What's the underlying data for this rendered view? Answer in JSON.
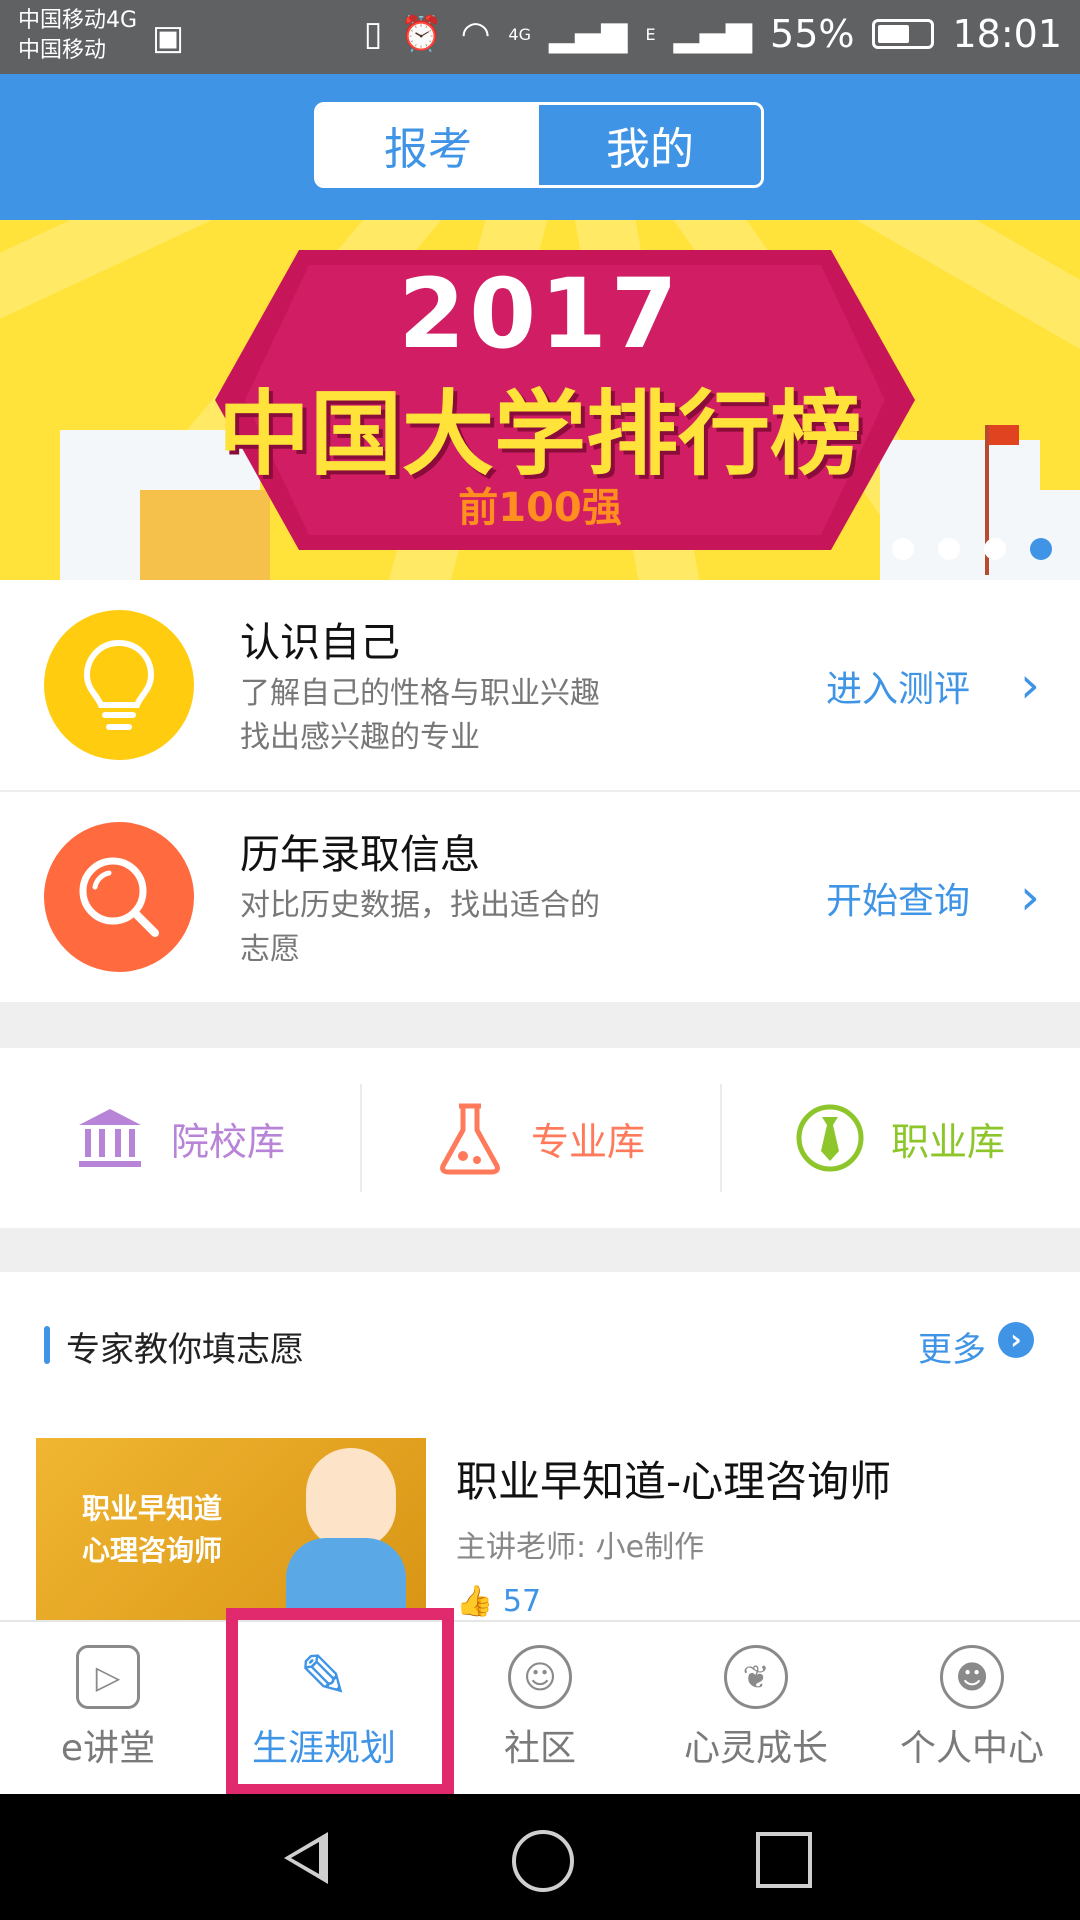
{
  "status_bar": {
    "carrier1": "中国移动4G",
    "carrier2": "中国移动",
    "network1": "4G",
    "network2": "E",
    "battery": "55%",
    "time": "18:01"
  },
  "header": {
    "tabs": [
      {
        "label": "报考",
        "active": true
      },
      {
        "label": "我的",
        "active": false
      }
    ]
  },
  "banner": {
    "year": "2017",
    "title": "中国大学排行榜",
    "subtitle": "前100强",
    "carousel_pages": 4,
    "carousel_active": 4
  },
  "features": [
    {
      "title": "认识自己",
      "desc": [
        "了解自己的性格与职业兴趣",
        "找出感兴趣的专业"
      ],
      "action": "进入测评",
      "icon": "lightbulb-icon",
      "color": "#ffcc10"
    },
    {
      "title": "历年录取信息",
      "desc": [
        "对比历史数据，找出适合的",
        "志愿"
      ],
      "action": "开始查询",
      "icon": "magnifier-icon",
      "color": "#ff6b3f"
    }
  ],
  "libraries": [
    {
      "label": "院校库",
      "icon": "university-icon",
      "color": "#b884d8"
    },
    {
      "label": "专业库",
      "icon": "flask-icon",
      "color": "#ff7a5a"
    },
    {
      "label": "职业库",
      "icon": "tie-icon",
      "color": "#8dc62a"
    }
  ],
  "expert": {
    "section_title": "专家教你填志愿",
    "more": "更多",
    "course": {
      "thumb_lines": [
        "职业早知道",
        "心理咨询师"
      ],
      "title": "职业早知道-心理咨询师",
      "teacher": "主讲老师: 小e制作",
      "likes": "57"
    }
  },
  "tabbar": [
    {
      "label": "e讲堂",
      "icon": "play-icon",
      "active": false
    },
    {
      "label": "生涯规划",
      "icon": "pen-icon",
      "active": true
    },
    {
      "label": "社区",
      "icon": "community-icon",
      "active": false
    },
    {
      "label": "心灵成长",
      "icon": "leaf-icon",
      "active": false
    },
    {
      "label": "个人中心",
      "icon": "person-icon",
      "active": false
    }
  ]
}
